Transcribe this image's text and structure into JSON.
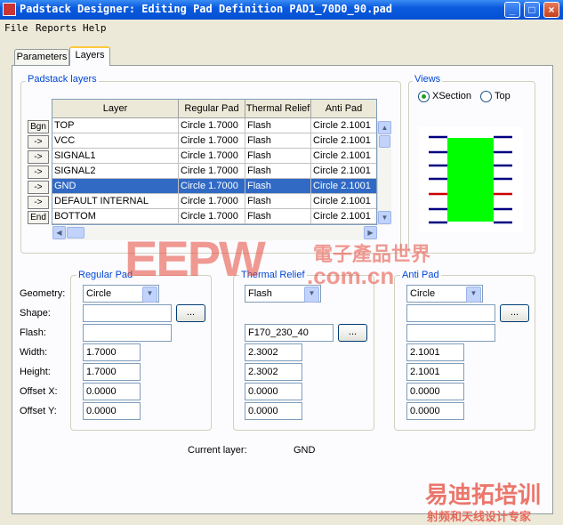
{
  "window": {
    "title": "Padstack Designer: Editing Pad Definition PAD1_70D0_90.pad",
    "controls": {
      "minimize": "_",
      "maximize": "□",
      "close": "×"
    }
  },
  "menu": [
    "File",
    "Reports",
    "Help"
  ],
  "tabs": [
    {
      "label": "Parameters",
      "active": false
    },
    {
      "label": "Layers",
      "active": true
    }
  ],
  "padstack_layers": {
    "group_label": "Padstack layers",
    "columns": [
      "Layer",
      "Regular Pad",
      "Thermal Relief",
      "Anti Pad"
    ],
    "rows": [
      {
        "btn": "Bgn",
        "layer": "TOP",
        "regular": "Circle 1.7000",
        "thermal": "Flash",
        "anti": "Circle 2.1001",
        "selected": false
      },
      {
        "btn": "->",
        "layer": "VCC",
        "regular": "Circle 1.7000",
        "thermal": "Flash",
        "anti": "Circle 2.1001",
        "selected": false
      },
      {
        "btn": "->",
        "layer": "SIGNAL1",
        "regular": "Circle 1.7000",
        "thermal": "Flash",
        "anti": "Circle 2.1001",
        "selected": false
      },
      {
        "btn": "->",
        "layer": "SIGNAL2",
        "regular": "Circle 1.7000",
        "thermal": "Flash",
        "anti": "Circle 2.1001",
        "selected": false
      },
      {
        "btn": "->",
        "layer": "GND",
        "regular": "Circle 1.7000",
        "thermal": "Flash",
        "anti": "Circle 2.1001",
        "selected": true
      },
      {
        "btn": "->",
        "layer": "DEFAULT INTERNAL",
        "regular": "Circle 1.7000",
        "thermal": "Flash",
        "anti": "Circle 2.1001",
        "selected": false
      },
      {
        "btn": "End",
        "layer": "BOTTOM",
        "regular": "Circle 1.7000",
        "thermal": "Flash",
        "anti": "Circle 2.1001",
        "selected": false
      }
    ]
  },
  "views": {
    "group_label": "Views",
    "options": [
      {
        "label": "XSection",
        "selected": true
      },
      {
        "label": "Top",
        "selected": false
      }
    ],
    "preview_colors": {
      "pad": "#00ff00",
      "layer_line": "#000080",
      "selected_line": "#cc0000"
    }
  },
  "row_labels": [
    "Geometry:",
    "Shape:",
    "Flash:",
    "Width:",
    "Height:",
    "Offset X:",
    "Offset Y:"
  ],
  "regular_pad": {
    "group_label": "Regular Pad",
    "geometry": "Circle",
    "shape": "",
    "flash": "",
    "width": "1.7000",
    "height": "1.7000",
    "offset_x": "0.0000",
    "offset_y": "0.0000"
  },
  "thermal_relief": {
    "group_label": "Thermal Relief",
    "geometry": "Flash",
    "flash": "F170_230_40",
    "width": "2.3002",
    "height": "2.3002",
    "offset_x": "0.0000",
    "offset_y": "0.0000"
  },
  "anti_pad": {
    "group_label": "Anti Pad",
    "geometry": "Circle",
    "shape": "",
    "flash": "",
    "width": "2.1001",
    "height": "2.1001",
    "offset_x": "0.0000",
    "offset_y": "0.0000"
  },
  "browse_label": "...",
  "current_layer": {
    "label": "Current layer:",
    "value": "GND"
  },
  "watermarks": {
    "top_main": "EEPW",
    "top_sub": ".com.cn",
    "top_cn": "電子產品世界",
    "bottom_main": "易迪拓培训",
    "bottom_sub": "射频和天线设计专家"
  }
}
